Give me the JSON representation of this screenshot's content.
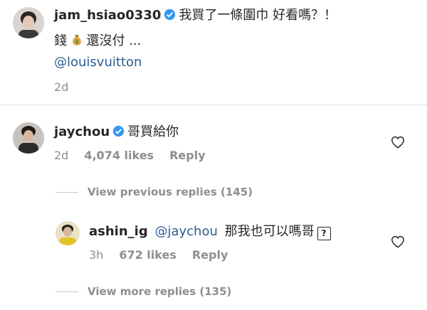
{
  "post": {
    "username": "jam_hsiao0330",
    "caption_line1": "我買了一條圍巾 好看嗎？！",
    "caption_line2_before": "錢",
    "caption_line2_after": "還沒付 ...",
    "money_emoji": "money-bag",
    "mention": "@louisvuitton",
    "time": "2d"
  },
  "comment": {
    "username": "jaychou",
    "text": "哥買給你",
    "time": "2d",
    "likes": "4,074 likes",
    "reply_label": "Reply"
  },
  "view_previous": "View previous replies (145)",
  "reply": {
    "username": "ashin_ig",
    "mention": "@jaychou",
    "text": "那我也可以嗎哥",
    "unknown_glyph": "?",
    "time": "3h",
    "likes": "672 likes",
    "reply_label": "Reply"
  },
  "view_more": "View more replies (135)",
  "colors": {
    "verified": "#3897f0",
    "link": "#2a5d92",
    "muted": "#8e8e8e"
  }
}
